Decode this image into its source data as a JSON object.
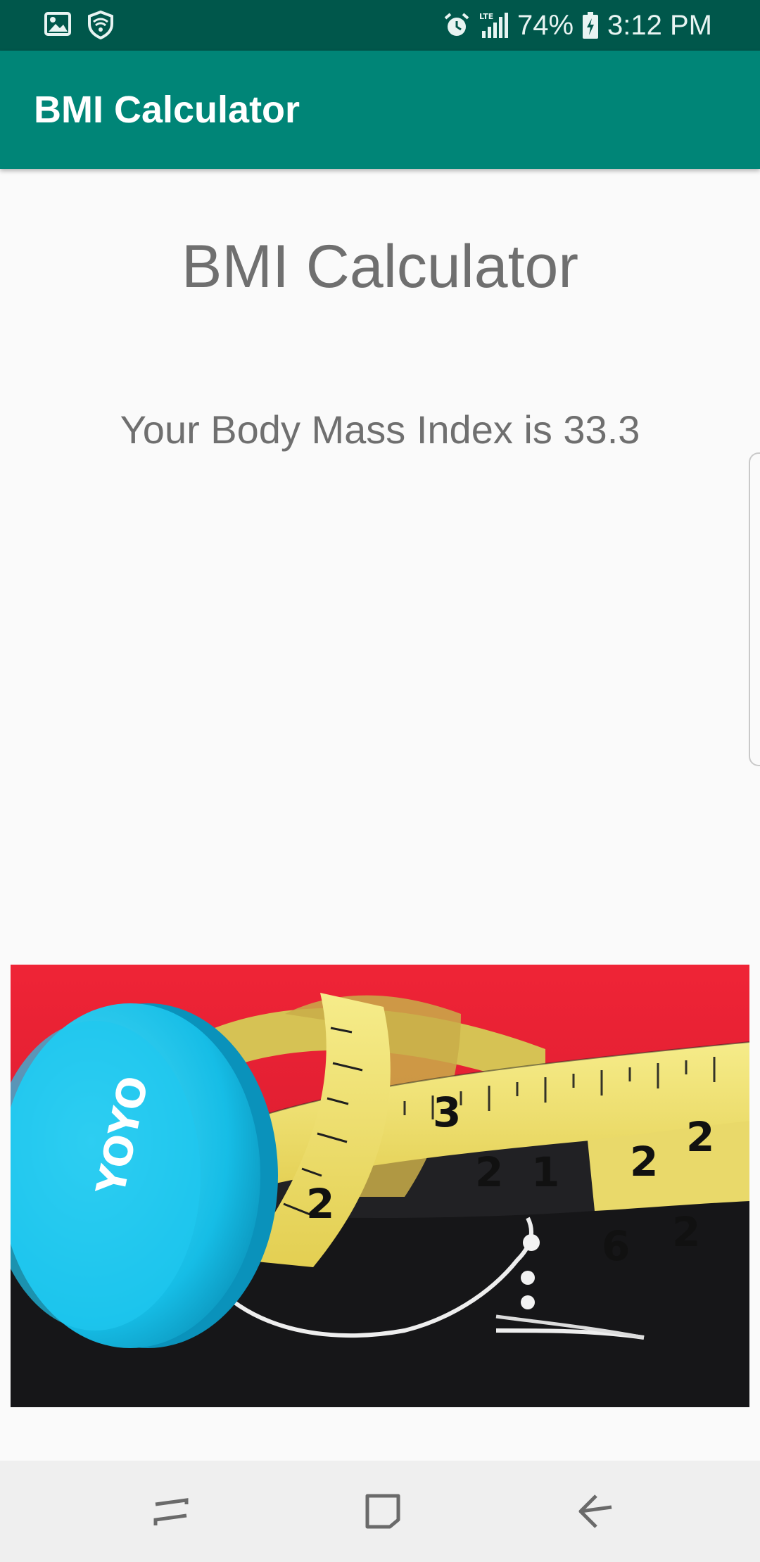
{
  "status_bar": {
    "battery_percent": "74%",
    "time": "3:12 PM",
    "network_label": "LTE",
    "icons": [
      "gallery-icon",
      "wifi-shield-icon",
      "alarm-icon",
      "signal-icon",
      "battery-icon"
    ]
  },
  "app_bar": {
    "title": "BMI Calculator",
    "color": "#008577"
  },
  "main": {
    "heading": "BMI Calculator",
    "result_text": "Your Body Mass Index is 33.3",
    "image": {
      "yoyo_text": "YOYO",
      "tape_numbers": [
        "3",
        "2",
        "1",
        "2",
        "2",
        "2",
        "6",
        "2"
      ]
    }
  },
  "nav_bar": {
    "buttons": [
      "recents-button",
      "home-button",
      "back-button"
    ]
  },
  "colors": {
    "status_bar": "#00574b",
    "accent": "#008577",
    "background": "#fafafa",
    "text": "#6f6f6f"
  }
}
